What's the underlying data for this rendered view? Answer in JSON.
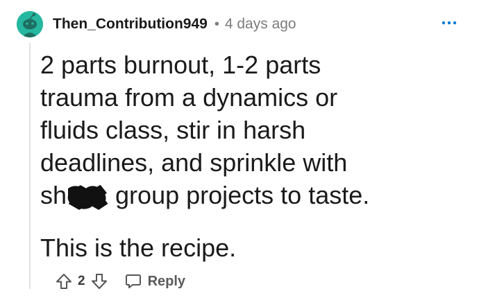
{
  "comment": {
    "username": "Then_Contribution949",
    "separator": "•",
    "timestamp": "4 days ago",
    "paragraph1": {
      "lines": [
        "2 parts burnout, 1-2 parts",
        "trauma from a dynamics or",
        "fluids class, stir in harsh",
        "deadlines, and sprinkle with"
      ],
      "last_line_prefix": "sh",
      "last_line_suffix": " group projects to taste."
    },
    "paragraph2": "This is the recipe.",
    "score": "2",
    "reply_label": "Reply"
  },
  "icons": {
    "avatar": "snoo-avatar",
    "more": "more-options-icon",
    "upvote": "upvote-arrow-icon",
    "downvote": "downvote-arrow-icon",
    "reply": "chat-bubble-icon",
    "censor": "censor-scribble"
  },
  "colors": {
    "avatar_bg": "#25b79f",
    "muted_text": "#7c7c7c",
    "more_dots": "#0079d3",
    "thread_line": "#e2e2e2"
  }
}
